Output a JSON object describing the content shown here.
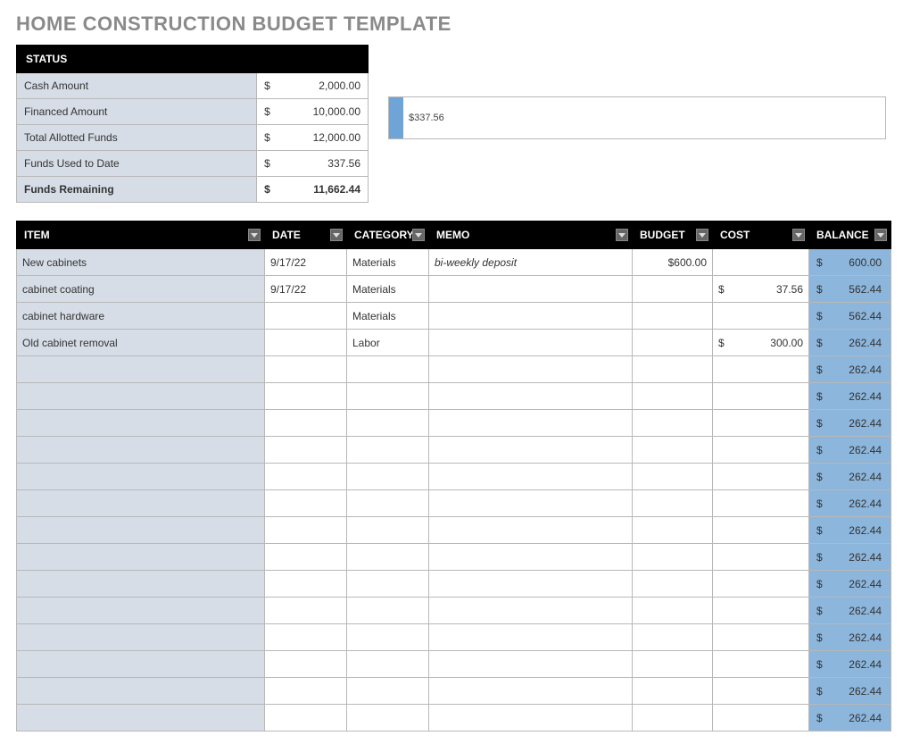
{
  "title": "HOME CONSTRUCTION BUDGET TEMPLATE",
  "status": {
    "header": "STATUS",
    "rows": [
      {
        "label": "Cash Amount",
        "cur": "$",
        "value": "2,000.00",
        "bold": false
      },
      {
        "label": "Financed Amount",
        "cur": "$",
        "value": "10,000.00",
        "bold": false
      },
      {
        "label": "Total Allotted Funds",
        "cur": "$",
        "value": "12,000.00",
        "bold": false
      },
      {
        "label": "Funds Used to Date",
        "cur": "$",
        "value": "337.56",
        "bold": false
      },
      {
        "label": "Funds Remaining",
        "cur": "$",
        "value": "11,662.44",
        "bold": true
      }
    ]
  },
  "chart_data": {
    "type": "bar",
    "orientation": "horizontal",
    "title": "",
    "xlim": [
      0,
      12000
    ],
    "series": [
      {
        "name": "Funds Used to Date",
        "value": 337.56,
        "label": "$337.56"
      }
    ]
  },
  "items": {
    "headers": {
      "item": "ITEM",
      "date": "DATE",
      "category": "CATEGORY",
      "memo": "MEMO",
      "budget": "BUDGET",
      "cost": "COST",
      "balance": "BALANCE"
    },
    "rows": [
      {
        "item": "New cabinets",
        "date": "9/17/22",
        "category": "Materials",
        "memo": "bi-weekly deposit",
        "budget": "$600.00",
        "cost_cur": "",
        "cost": "",
        "bal_cur": "$",
        "balance": "600.00"
      },
      {
        "item": "cabinet coating",
        "date": "9/17/22",
        "category": "Materials",
        "memo": "",
        "budget": "",
        "cost_cur": "$",
        "cost": "37.56",
        "bal_cur": "$",
        "balance": "562.44"
      },
      {
        "item": "cabinet hardware",
        "date": "",
        "category": "Materials",
        "memo": "",
        "budget": "",
        "cost_cur": "",
        "cost": "",
        "bal_cur": "$",
        "balance": "562.44"
      },
      {
        "item": "Old cabinet removal",
        "date": "",
        "category": "Labor",
        "memo": "",
        "budget": "",
        "cost_cur": "$",
        "cost": "300.00",
        "bal_cur": "$",
        "balance": "262.44"
      },
      {
        "item": "",
        "date": "",
        "category": "",
        "memo": "",
        "budget": "",
        "cost_cur": "",
        "cost": "",
        "bal_cur": "$",
        "balance": "262.44"
      },
      {
        "item": "",
        "date": "",
        "category": "",
        "memo": "",
        "budget": "",
        "cost_cur": "",
        "cost": "",
        "bal_cur": "$",
        "balance": "262.44"
      },
      {
        "item": "",
        "date": "",
        "category": "",
        "memo": "",
        "budget": "",
        "cost_cur": "",
        "cost": "",
        "bal_cur": "$",
        "balance": "262.44"
      },
      {
        "item": "",
        "date": "",
        "category": "",
        "memo": "",
        "budget": "",
        "cost_cur": "",
        "cost": "",
        "bal_cur": "$",
        "balance": "262.44"
      },
      {
        "item": "",
        "date": "",
        "category": "",
        "memo": "",
        "budget": "",
        "cost_cur": "",
        "cost": "",
        "bal_cur": "$",
        "balance": "262.44"
      },
      {
        "item": "",
        "date": "",
        "category": "",
        "memo": "",
        "budget": "",
        "cost_cur": "",
        "cost": "",
        "bal_cur": "$",
        "balance": "262.44"
      },
      {
        "item": "",
        "date": "",
        "category": "",
        "memo": "",
        "budget": "",
        "cost_cur": "",
        "cost": "",
        "bal_cur": "$",
        "balance": "262.44"
      },
      {
        "item": "",
        "date": "",
        "category": "",
        "memo": "",
        "budget": "",
        "cost_cur": "",
        "cost": "",
        "bal_cur": "$",
        "balance": "262.44"
      },
      {
        "item": "",
        "date": "",
        "category": "",
        "memo": "",
        "budget": "",
        "cost_cur": "",
        "cost": "",
        "bal_cur": "$",
        "balance": "262.44"
      },
      {
        "item": "",
        "date": "",
        "category": "",
        "memo": "",
        "budget": "",
        "cost_cur": "",
        "cost": "",
        "bal_cur": "$",
        "balance": "262.44"
      },
      {
        "item": "",
        "date": "",
        "category": "",
        "memo": "",
        "budget": "",
        "cost_cur": "",
        "cost": "",
        "bal_cur": "$",
        "balance": "262.44"
      },
      {
        "item": "",
        "date": "",
        "category": "",
        "memo": "",
        "budget": "",
        "cost_cur": "",
        "cost": "",
        "bal_cur": "$",
        "balance": "262.44"
      },
      {
        "item": "",
        "date": "",
        "category": "",
        "memo": "",
        "budget": "",
        "cost_cur": "",
        "cost": "",
        "bal_cur": "$",
        "balance": "262.44"
      },
      {
        "item": "",
        "date": "",
        "category": "",
        "memo": "",
        "budget": "",
        "cost_cur": "",
        "cost": "",
        "bal_cur": "$",
        "balance": "262.44"
      }
    ]
  }
}
